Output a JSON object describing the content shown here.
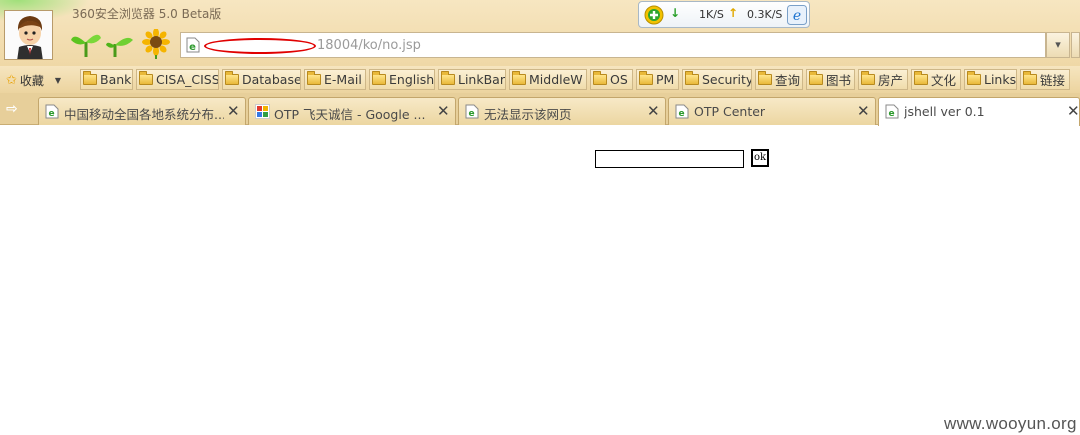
{
  "window": {
    "title": "360安全浏览器 5.0 Beta版"
  },
  "speed": {
    "download": "1K/S",
    "upload": "0.3K/S"
  },
  "address": {
    "url": "18004/ko/no.jsp"
  },
  "favorites": {
    "label": "收藏",
    "items": [
      "Bank",
      "CISA_CISS",
      "Database",
      "E-Mail",
      "English",
      "LinkBar",
      "MiddleW",
      "OS",
      "PM",
      "Security",
      "查询",
      "图书",
      "房产",
      "文化",
      "Links",
      "链接"
    ]
  },
  "tabs": [
    {
      "title": "中国移动全国各地系统分布...",
      "icon": "ie-page-icon",
      "active": false
    },
    {
      "title": "OTP 飞天诚信 - Google ...",
      "icon": "google-icon",
      "active": false
    },
    {
      "title": "无法显示该网页",
      "icon": "ie-page-icon",
      "active": false
    },
    {
      "title": "OTP Center",
      "icon": "ie-page-icon",
      "active": false
    },
    {
      "title": "jshell ver 0.1",
      "icon": "ie-page-icon",
      "active": true
    }
  ],
  "content": {
    "ok_label": "ok",
    "command_value": ""
  },
  "watermark": "www.wooyun.org",
  "colors": {
    "chrome_bg": "#efd8a6",
    "redaction": "#e00000"
  }
}
